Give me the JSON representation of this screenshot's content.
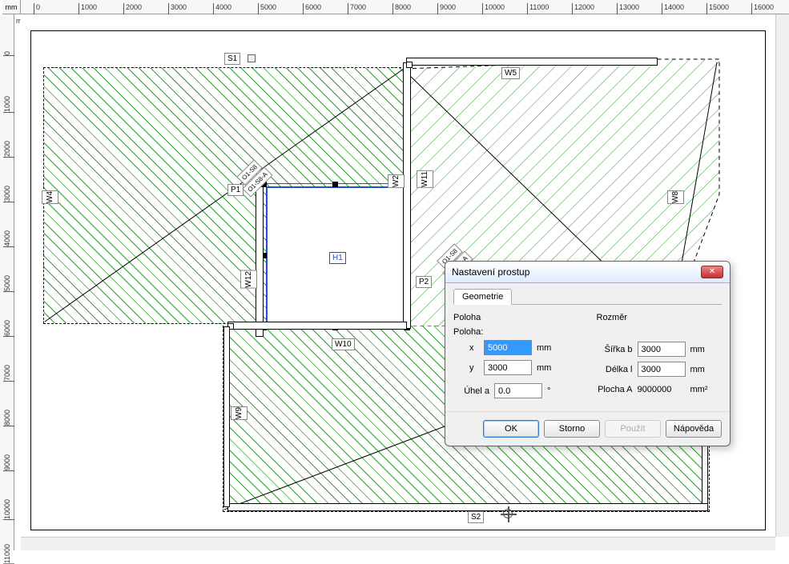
{
  "ruler": {
    "unit_h": "mm",
    "unit_v": "mm",
    "h_ticks": [
      "0",
      "1000",
      "2000",
      "3000",
      "4000",
      "5000",
      "6000",
      "7000",
      "8000",
      "9000",
      "10000",
      "11000",
      "12000",
      "13000",
      "14000",
      "15000",
      "16000"
    ],
    "v_ticks": [
      "0",
      "1000",
      "2000",
      "3000",
      "4000",
      "5000",
      "6000",
      "7000",
      "8000",
      "9000",
      "10000",
      "11000"
    ]
  },
  "labels": {
    "s1": "S1",
    "s2": "S2",
    "w4": "W4",
    "w5": "W5",
    "w8": "W8",
    "w2": "W2",
    "w9": "W9",
    "w10": "W10",
    "w11": "W11",
    "w12": "W12",
    "p1": "P1",
    "p2": "P2",
    "h1": "H1",
    "o1ssa": "O1-S8-A",
    "o1ss": "O1-S8"
  },
  "dialog": {
    "title": "Nastavení prostup",
    "tab": "Geometrie",
    "section_left": "Poloha",
    "poloha_label": "Poloha:",
    "x_label": "x",
    "x_value": "5000",
    "x_unit": "mm",
    "y_label": "y",
    "y_value": "3000",
    "y_unit": "mm",
    "angle_label": "Úhel a",
    "angle_value": "0.0",
    "angle_unit": "°",
    "section_right": "Rozměr",
    "width_label": "Šířka b",
    "width_value": "3000",
    "width_unit": "mm",
    "length_label": "Délka l",
    "length_value": "3000",
    "length_unit": "mm",
    "area_label": "Plocha A",
    "area_value": "9000000",
    "area_unit": "mm²",
    "btn_ok": "OK",
    "btn_cancel": "Storno",
    "btn_apply": "Použít",
    "btn_help": "Nápověda"
  }
}
